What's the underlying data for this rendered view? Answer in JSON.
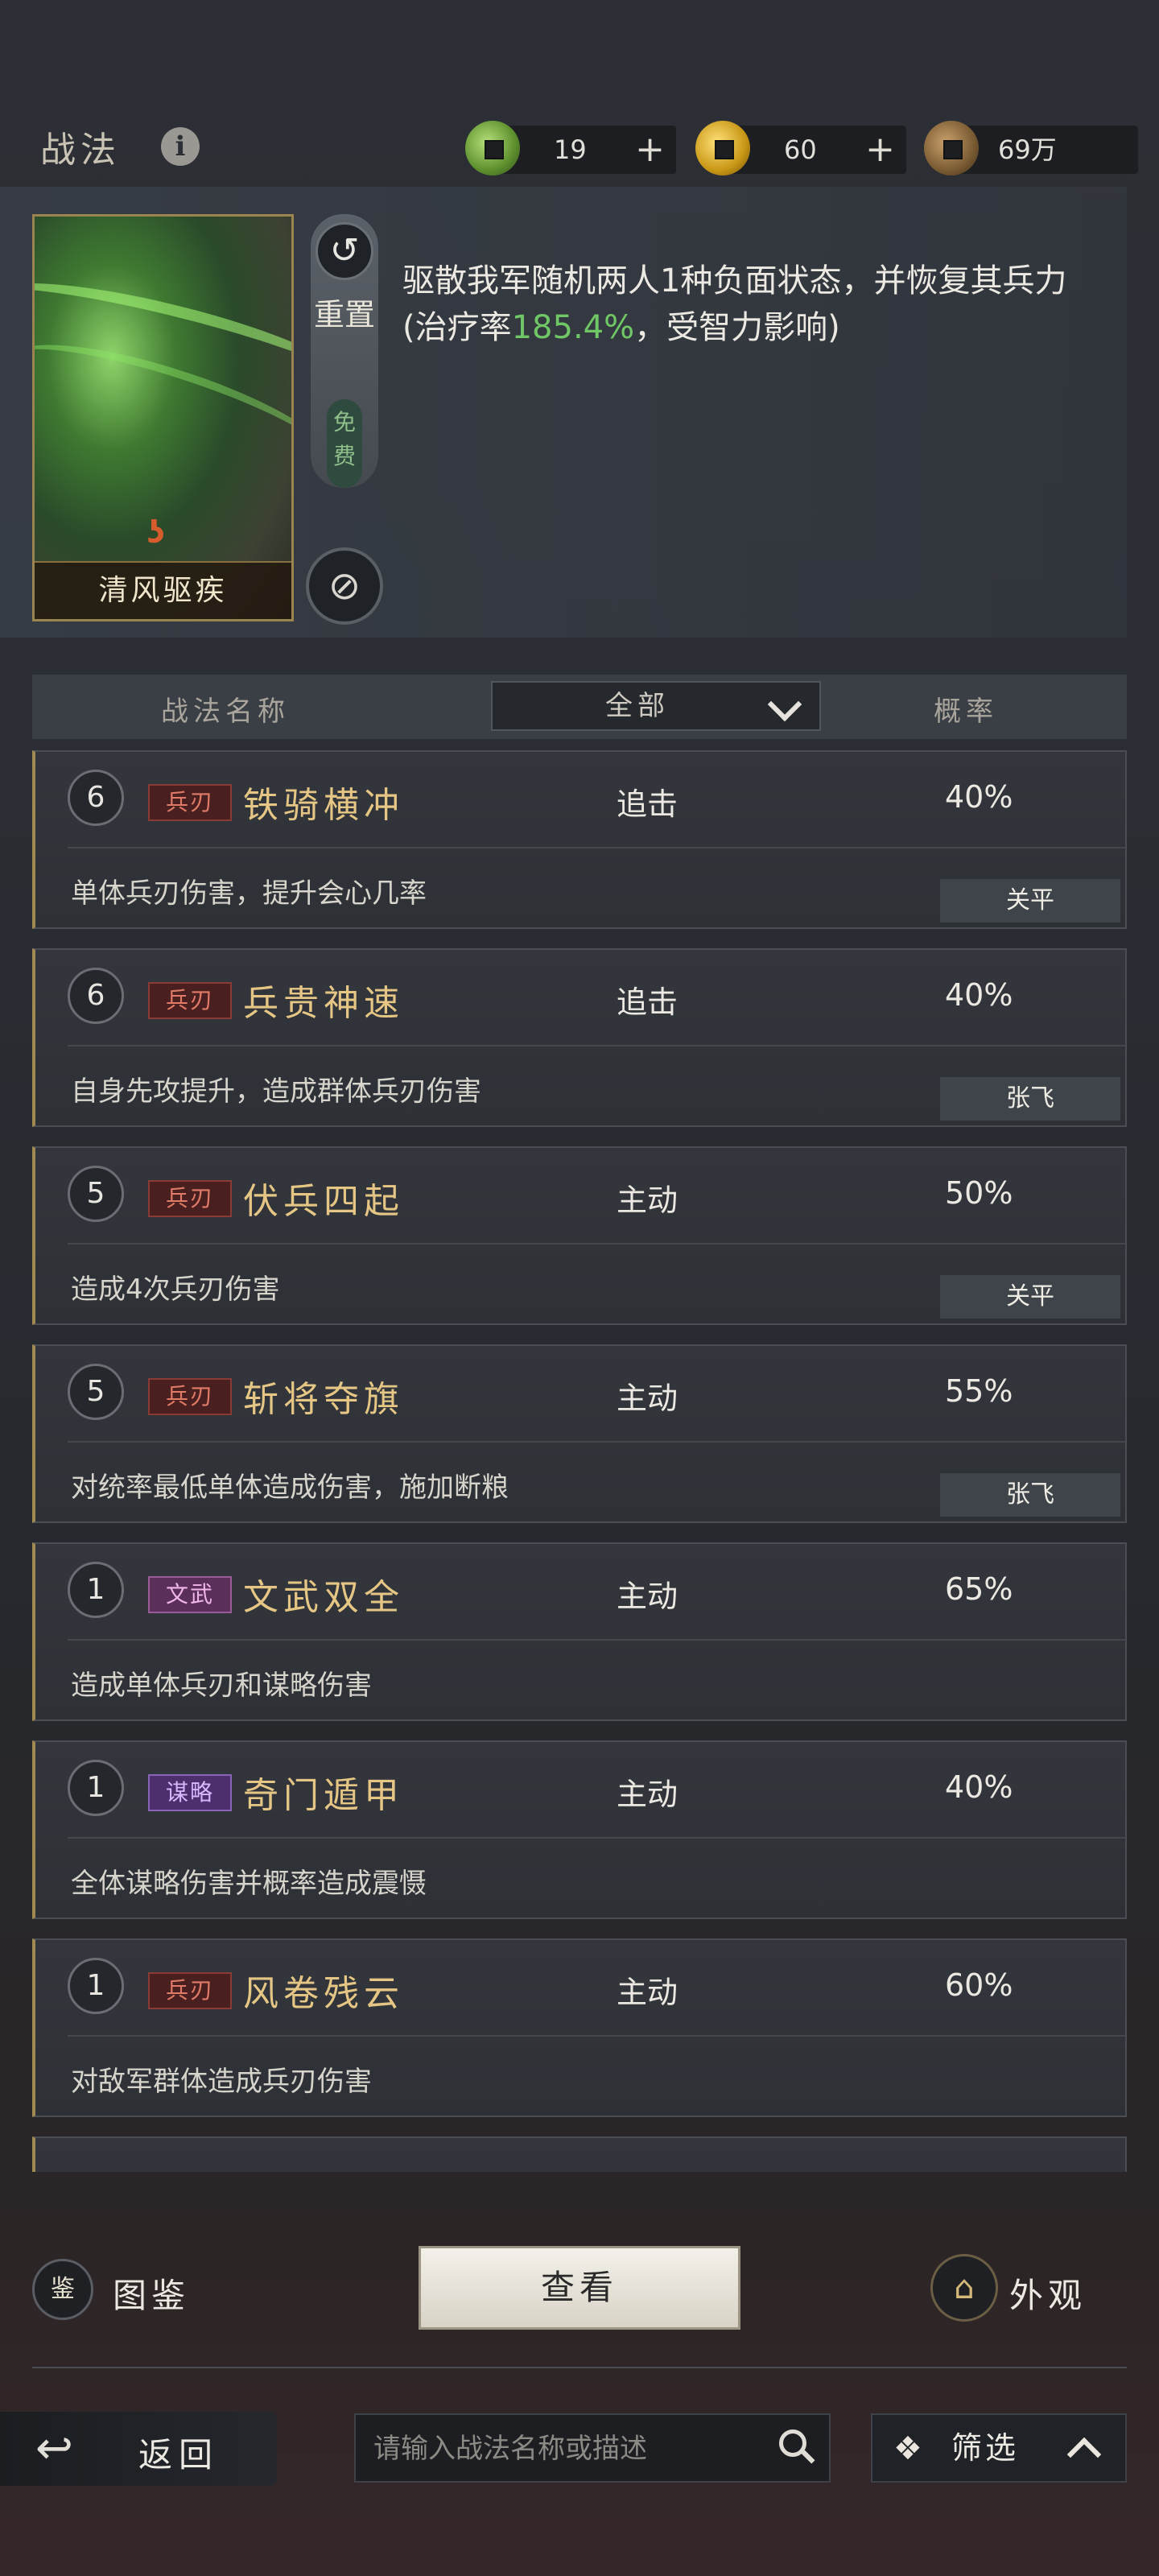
{
  "header": {
    "title": "战法",
    "info_icon": "i",
    "resources": [
      {
        "name": "jade-coin",
        "value": "19",
        "plus": "+"
      },
      {
        "name": "gold-coin",
        "value": "60",
        "plus": "+"
      },
      {
        "name": "copper-coin",
        "value": "69万"
      }
    ]
  },
  "selected": {
    "card_name": "清风驱疾",
    "card_mark": "ʖ",
    "reset_label": "重置",
    "free_label": "免费",
    "desc_part1": "驱散我军随机两人1种负面状态，并恢复其兵力(治疗率",
    "desc_highlight": "185.4%",
    "desc_part2": "，受智力影响)"
  },
  "table": {
    "col_name": "战法名称",
    "filter_value": "全部",
    "col_rate": "概率"
  },
  "rows": [
    {
      "level": "6",
      "tag": "兵刃",
      "name": "铁骑横冲",
      "type": "追击",
      "rate": "40%",
      "desc": "单体兵刃伤害，提升会心几率",
      "hero": "关平"
    },
    {
      "level": "6",
      "tag": "兵刃",
      "name": "兵贵神速",
      "type": "追击",
      "rate": "40%",
      "desc": "自身先攻提升，造成群体兵刃伤害",
      "hero": "张飞"
    },
    {
      "level": "5",
      "tag": "兵刃",
      "name": "伏兵四起",
      "type": "主动",
      "rate": "50%",
      "desc": "造成4次兵刃伤害",
      "hero": "关平"
    },
    {
      "level": "5",
      "tag": "兵刃",
      "name": "斩将夺旗",
      "type": "主动",
      "rate": "55%",
      "desc": "对统率最低单体造成伤害，施加断粮",
      "hero": "张飞"
    },
    {
      "level": "1",
      "tag": "文武",
      "name": "文武双全",
      "type": "主动",
      "rate": "65%",
      "desc": "造成单体兵刃和谋略伤害",
      "hero": ""
    },
    {
      "level": "1",
      "tag": "谋略",
      "name": "奇门遁甲",
      "type": "主动",
      "rate": "40%",
      "desc": "全体谋略伤害并概率造成震慑",
      "hero": ""
    },
    {
      "level": "1",
      "tag": "兵刃",
      "name": "风卷残云",
      "type": "主动",
      "rate": "60%",
      "desc": "对敌军群体造成兵刃伤害",
      "hero": ""
    }
  ],
  "bottom": {
    "atlas_icon": "鉴",
    "atlas_label": "图鉴",
    "view_label": "查看",
    "look_icon": "⌂",
    "look_label": "外观",
    "back_label": "返回",
    "search_placeholder": "请输入战法名称或描述",
    "filter_label": "筛选"
  },
  "colors": {
    "highlight_green": "#6fc766",
    "skill_name_gold": "#e6c684",
    "tag_bing": "#e07b68",
    "tag_wenwu": "#f0b6ea",
    "tag_mou": "#d8b8ff"
  }
}
